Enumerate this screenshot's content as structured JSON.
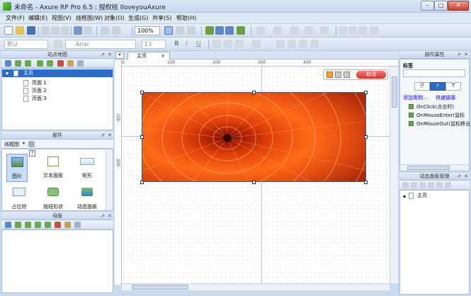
{
  "window": {
    "title": "未命名 - Axure RP Pro 6.5 : 授权给 IloveyouAxure",
    "min": "–",
    "max": "□",
    "close": "✕"
  },
  "menu": [
    "文件(F)",
    "编辑(E)",
    "视图(V)",
    "线框图(W)",
    "对象(O)",
    "生成(G)",
    "共享(S)",
    "帮助(H)"
  ],
  "toolbar": {
    "zoom": "100%",
    "font_style": "默认",
    "font_family": "Arial",
    "font_size": "13",
    "bold": "B",
    "italic": "I",
    "underline": "U"
  },
  "sitemap": {
    "title": "站点地图",
    "root": "主页",
    "pages": [
      "页面 1",
      "页面 2",
      "页面 3"
    ]
  },
  "widgets": {
    "title": "部件",
    "library": "线框图",
    "items": [
      "图片",
      "文本面板",
      "矩形",
      "占位符",
      "按钮形状",
      "动态面板"
    ]
  },
  "masters": {
    "title": "母版"
  },
  "tab": {
    "label": "主页",
    "close": "×"
  },
  "ruler": {
    "h": [
      "0",
      "100",
      "200",
      "300",
      "400"
    ],
    "v": [
      "100",
      "200"
    ]
  },
  "inline_edit": {
    "cancel": "取消"
  },
  "props": {
    "title": "部件属性",
    "label": "标签",
    "add_case": "添加用例...",
    "quick_link": "快速链接",
    "events": [
      "OnClick(点击时)",
      "OnMouseEnter(鼠标",
      "OnMouseOut(鼠标移出"
    ]
  },
  "dpanel": {
    "title": "动态面板管理",
    "root": "主页"
  },
  "colors": {
    "accent": "#316ac5",
    "link": "#0000ee",
    "chrome": "#c9d9ee",
    "cancel": "#e84a4a"
  }
}
